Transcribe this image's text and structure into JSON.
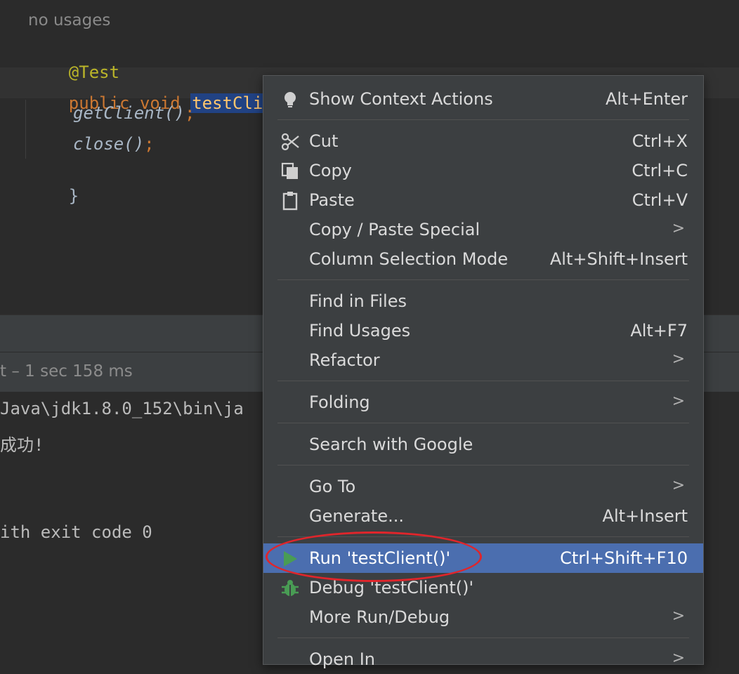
{
  "editor": {
    "hint": "no usages",
    "annotation": "@Test",
    "kw_public": "public",
    "kw_void": "void",
    "method": "testClien",
    "line_call1": "getClient()",
    "line_call2": "close()",
    "semi": ";",
    "close_brace": "}"
  },
  "run_panel": {
    "status": "t – 1 sec 158 ms",
    "console": [
      "Java\\jdk1.8.0_152\\bin\\ja",
      "成功!",
      "ith exit code 0"
    ]
  },
  "menu": {
    "items": [
      {
        "label": "Show Context Actions",
        "shortcut": "Alt+Enter",
        "icon": "lightbulb-icon"
      },
      {
        "label": "Cut",
        "shortcut": "Ctrl+X",
        "icon": "scissors-icon"
      },
      {
        "label": "Copy",
        "shortcut": "Ctrl+C",
        "icon": "copy-icon"
      },
      {
        "label": "Paste",
        "shortcut": "Ctrl+V",
        "icon": "clipboard-icon"
      },
      {
        "label": "Copy / Paste Special",
        "shortcut": ""
      },
      {
        "label": "Column Selection Mode",
        "shortcut": "Alt+Shift+Insert"
      },
      {
        "label": "Find in Files",
        "shortcut": ""
      },
      {
        "label": "Find Usages",
        "shortcut": "Alt+F7"
      },
      {
        "label": "Refactor",
        "shortcut": ""
      },
      {
        "label": "Folding",
        "shortcut": ""
      },
      {
        "label": "Search with Google",
        "shortcut": ""
      },
      {
        "label": "Go To",
        "shortcut": ""
      },
      {
        "label": "Generate...",
        "shortcut": "Alt+Insert"
      },
      {
        "label": "Run 'testClient()'",
        "shortcut": "Ctrl+Shift+F10",
        "icon": "run-play-icon"
      },
      {
        "label": "Debug 'testClient()'",
        "shortcut": "",
        "icon": "debug-bug-icon"
      },
      {
        "label": "More Run/Debug",
        "shortcut": ""
      },
      {
        "label": "Open In",
        "shortcut": ""
      }
    ],
    "submenu_arrow": ">"
  },
  "colors": {
    "menu_bg": "#3c3f41",
    "highlight": "#4b6eaf",
    "callout": "#e0252b",
    "run_icon": "#499c54",
    "debug_icon": "#499c54"
  }
}
